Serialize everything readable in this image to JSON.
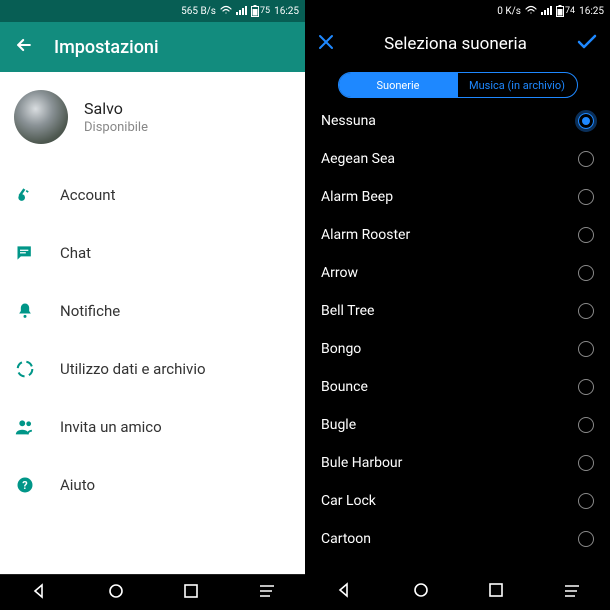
{
  "left": {
    "status": {
      "rate": "565 B/s",
      "battery": "75",
      "time": "16:25"
    },
    "header_title": "Impostazioni",
    "profile": {
      "name": "Salvo",
      "subtitle": "Disponibile"
    },
    "items": [
      {
        "icon": "key-icon",
        "label": "Account"
      },
      {
        "icon": "chat-icon",
        "label": "Chat"
      },
      {
        "icon": "bell-icon",
        "label": "Notifiche"
      },
      {
        "icon": "data-icon",
        "label": "Utilizzo dati e archivio"
      },
      {
        "icon": "invite-icon",
        "label": "Invita un amico"
      },
      {
        "icon": "help-icon",
        "label": "Aiuto"
      }
    ]
  },
  "right": {
    "status": {
      "rate": "0 K/s",
      "battery": "74",
      "time": "16:25"
    },
    "header_title": "Seleziona suoneria",
    "segmented": {
      "active": "Suonerie",
      "inactive": "Musica (in archivio)"
    },
    "ringtones": [
      {
        "label": "Nessuna",
        "selected": true
      },
      {
        "label": "Aegean Sea",
        "selected": false
      },
      {
        "label": "Alarm Beep",
        "selected": false
      },
      {
        "label": "Alarm Rooster",
        "selected": false
      },
      {
        "label": "Arrow",
        "selected": false
      },
      {
        "label": "Bell Tree",
        "selected": false
      },
      {
        "label": "Bongo",
        "selected": false
      },
      {
        "label": "Bounce",
        "selected": false
      },
      {
        "label": "Bugle",
        "selected": false
      },
      {
        "label": "Bule Harbour",
        "selected": false
      },
      {
        "label": "Car Lock",
        "selected": false
      },
      {
        "label": "Cartoon",
        "selected": false
      }
    ]
  }
}
